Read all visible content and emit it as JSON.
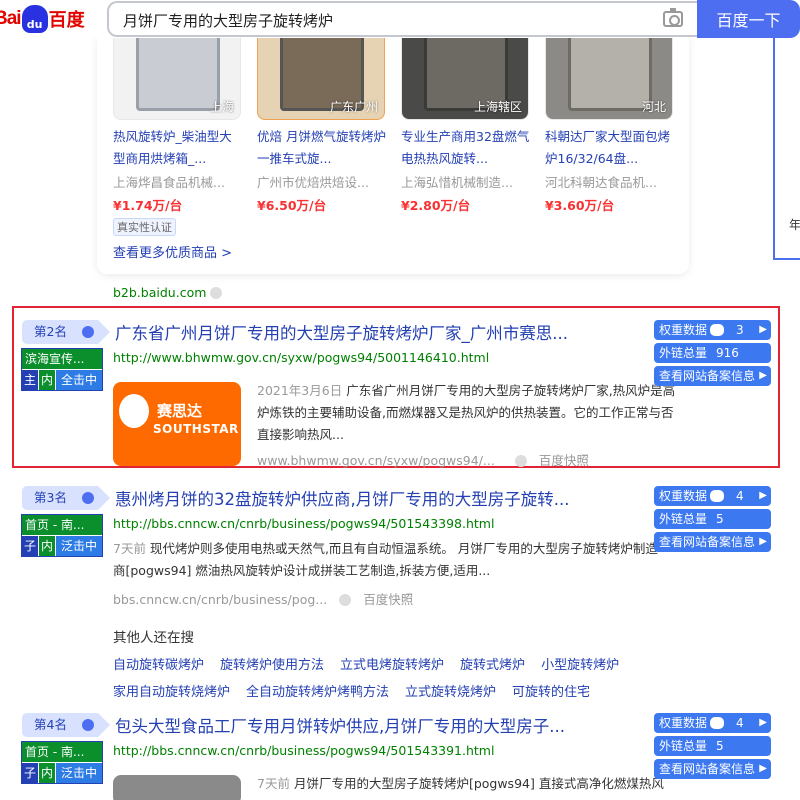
{
  "header": {
    "logo_bai": "Bai",
    "logo_du_paw": "du",
    "logo_baidu": "百度",
    "query": "月饼厂专用的大型房子旋转烤炉",
    "search_button": "百度一下"
  },
  "side": {
    "text": "年"
  },
  "products": {
    "items": [
      {
        "location": "上海",
        "title": "热风旋转炉_柴油型大型商用烘烤箱_...",
        "company": "上海烨昌食品机械...",
        "price": "¥1.74万/台",
        "badge": "真实性认证"
      },
      {
        "location": "广东广州",
        "title": "优焙 月饼燃气旋转烤炉 一推车式旋...",
        "company": "广州市优焙烘焙设...",
        "price": "¥6.50万/台",
        "badge": ""
      },
      {
        "location": "上海辖区",
        "title": "专业生产商用32盘燃气电热热风旋转...",
        "company": "上海弘惜机械制造...",
        "price": "¥2.80万/台",
        "badge": ""
      },
      {
        "location": "河北",
        "title": "科朝达厂家大型面包烤炉16/32/64盘...",
        "company": "河北科朝达食品机...",
        "price": "¥3.60万/台",
        "badge": ""
      }
    ],
    "more": "查看更多优质商品 >",
    "source": "b2b.baidu.com"
  },
  "results": [
    {
      "rank": "第2名",
      "tag_top": "滨海宣传...",
      "tag_a": "主",
      "tag_b": "内",
      "tag_c": "全击中",
      "title": "广东省广州月饼厂专用的大型房子旋转烤炉厂家_广州市赛思...",
      "url": "http://www.bhwmw.gov.cn/syxw/pogws94/5001146410.html",
      "date": "2021年3月6日",
      "desc": "广东省广州月饼厂专用的大型房子旋转烤炉厂家,热风炉是高炉炼铁的主要辅助设备,而燃煤器又是热风炉的供热装置。它的工作正常与否直接影响热风...",
      "foot_url": "www.bhwmw.gov.cn/syxw/pogws94/...",
      "snapshot": "百度快照",
      "thumb_cn": "赛思达",
      "thumb_en": "SOUTHSTAR",
      "weight_label": "权重数据",
      "weight_value": "3",
      "links_label": "外链总量",
      "links_value": "916",
      "icp_label": "查看网站备案信息"
    },
    {
      "rank": "第3名",
      "tag_top": "首页 - 南...",
      "tag_a": "子",
      "tag_b": "内",
      "tag_c": "泛击中",
      "title": "惠州烤月饼的32盘旋转炉供应商,月饼厂专用的大型房子旋转...",
      "url": "http://bbs.cnncw.cn/cnrb/business/pogws94/501543398.html",
      "date": "7天前",
      "desc": "现代烤炉则多使用电热或天然气,而且有自动恒温系统。 月饼厂专用的大型房子旋转烤炉制造商[pogws94] 燃油热风旋转炉设计成拼装工艺制造,拆装方便,适用...",
      "foot_url": "bbs.cnncw.cn/cnrb/business/pog...",
      "snapshot": "百度快照",
      "weight_label": "权重数据",
      "weight_value": "4",
      "links_label": "外链总量",
      "links_value": "5",
      "icp_label": "查看网站备案信息"
    },
    {
      "rank": "第4名",
      "tag_top": "首页 - 南...",
      "tag_a": "子",
      "tag_b": "内",
      "tag_c": "泛击中",
      "title": "包头大型食品工厂专用月饼转炉供应,月饼厂专用的大型房子...",
      "url": "http://bbs.cnncw.cn/cnrb/business/pogws94/501543391.html",
      "date": "7天前",
      "desc": "月饼厂专用的大型房子旋转烤炉[pogws94] 直接式高净化燃煤热风",
      "weight_label": "权重数据",
      "weight_value": "4",
      "links_label": "外链总量",
      "links_value": "5",
      "icp_label": "查看网站备案信息"
    }
  ],
  "related": {
    "heading": "其他人还在搜",
    "row1": [
      "自动旋转碳烤炉",
      "旋转烤炉使用方法",
      "立式电烤旋转烤炉",
      "旋转式烤炉",
      "小型旋转烤炉"
    ],
    "row2": [
      "家用自动旋转烧烤炉",
      "全自动旋转烤炉烤鸭方法",
      "立式旋转烧烤炉",
      "可旋转的住宅"
    ]
  },
  "colors": {
    "brand": "#4e6ef2",
    "link": "#2440b3",
    "highlight": "#f73131",
    "url_green": "#008000",
    "highlight_box": "#e02433"
  },
  "icons": [
    "camera-icon",
    "paw-icon",
    "chevron-right-icon",
    "circle-dot-icon"
  ]
}
